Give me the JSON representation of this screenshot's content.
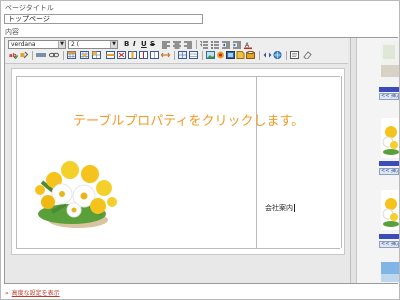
{
  "page_title_label": "ページタイトル",
  "page_title_value": "トップページ",
  "content_label": "内容",
  "toolbar": {
    "font_family": "verdana",
    "font_size": "2 ("
  },
  "instruction_text": "テーブルプロパティをクリックします。",
  "editor_text": "会社案内",
  "sidebar": {
    "insert_label": "<< 挿入す"
  },
  "advanced_settings_link": "高度な設定を表示",
  "colors": {
    "instruction": "#f39a28",
    "link": "#c0392b"
  }
}
